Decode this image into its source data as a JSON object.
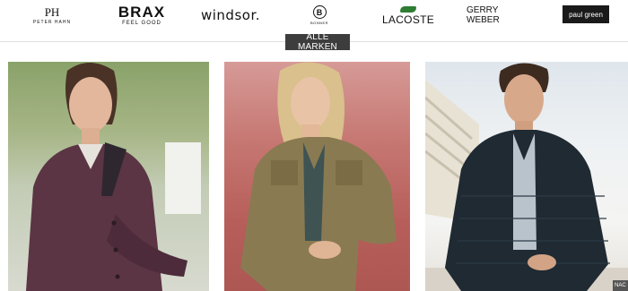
{
  "brands": [
    {
      "id": "peter-hahn",
      "mark": "PH",
      "name": "PETER HAHN"
    },
    {
      "id": "brax",
      "name": "BRAX",
      "tagline": "FEEL GOOD"
    },
    {
      "id": "windsor",
      "name": "windsor."
    },
    {
      "id": "bonner",
      "mark": "B",
      "name": "BONNER"
    },
    {
      "id": "lacoste",
      "name": "LACOSTE"
    },
    {
      "id": "gerry-weber",
      "name": "GERRY WEBER"
    },
    {
      "id": "paul-green",
      "name": "paul green"
    }
  ],
  "all_brands_button": "ALLE MARKEN",
  "next_tab_label": "NAC",
  "colors": {
    "button_bg": "#3d3d3d",
    "tile1_bg": "#a6b585",
    "tile2_bg": "#c67772",
    "tile3_bg": "#eef1f3"
  },
  "tiles": [
    {
      "id": "tile-1",
      "subject": "woman in bordeaux wool jacket"
    },
    {
      "id": "tile-2",
      "subject": "woman in khaki shirt jacket"
    },
    {
      "id": "tile-3",
      "subject": "man in navy quilted jacket"
    }
  ]
}
